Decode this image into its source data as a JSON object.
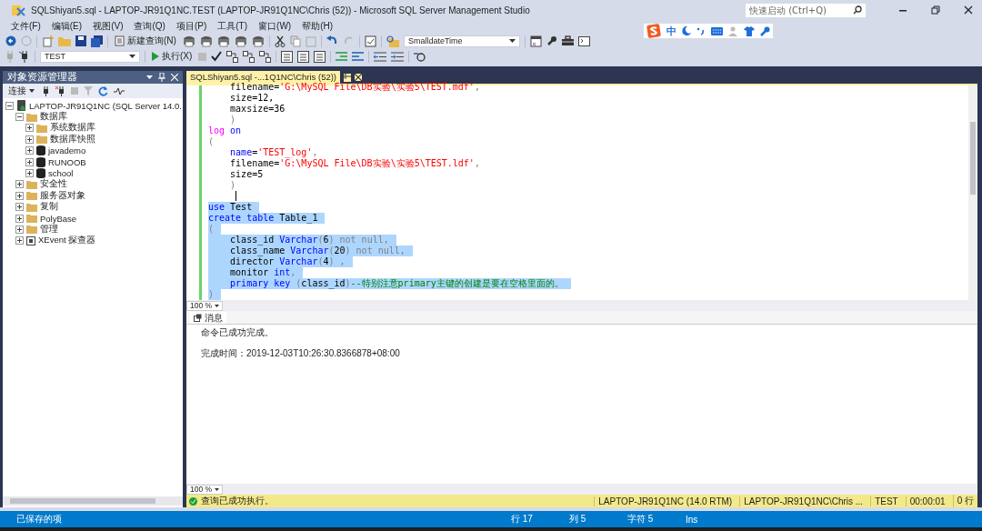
{
  "window": {
    "title": "SQLShiyan5.sql - LAPTOP-JR91Q1NC.TEST (LAPTOP-JR91Q1NC\\Chris (52)) - Microsoft SQL Server Management Studio",
    "quick_launch": {
      "placeholder": "快速启动 (Ctrl+Q)"
    }
  },
  "menu": [
    "文件(F)",
    "编辑(E)",
    "视图(V)",
    "查询(Q)",
    "项目(P)",
    "工具(T)",
    "窗口(W)",
    "帮助(H)"
  ],
  "toolbar": {
    "new_query": "新建查询(N)",
    "type_combo": "SmalldateTime",
    "database_combo": "TEST",
    "execute": "执行(X)"
  },
  "ime_bar": {
    "mode": "中"
  },
  "object_explorer": {
    "title": "对象资源管理器",
    "connect": "连接",
    "tree": [
      {
        "label": "LAPTOP-JR91Q1NC (SQL Server 14.0.",
        "kind": "server",
        "expanded": true,
        "children": [
          {
            "label": "数据库",
            "kind": "folder",
            "expanded": true,
            "children": [
              {
                "label": "系统数据库",
                "kind": "folder",
                "expanded": false
              },
              {
                "label": "数据库快照",
                "kind": "folder",
                "expanded": false
              },
              {
                "label": "javademo",
                "kind": "database",
                "expanded": false
              },
              {
                "label": "RUNOOB",
                "kind": "database",
                "expanded": false
              },
              {
                "label": "school",
                "kind": "database",
                "expanded": false
              }
            ]
          },
          {
            "label": "安全性",
            "kind": "folder",
            "expanded": false
          },
          {
            "label": "服务器对象",
            "kind": "folder",
            "expanded": false
          },
          {
            "label": "复制",
            "kind": "folder",
            "expanded": false
          },
          {
            "label": "PolyBase",
            "kind": "folder",
            "expanded": false
          },
          {
            "label": "管理",
            "kind": "folder",
            "expanded": false
          },
          {
            "label": "XEvent 探查器",
            "kind": "xevent",
            "expanded": false
          }
        ]
      }
    ]
  },
  "editor_tab": {
    "title": "SQLShiyan5.sql -...1Q1NC\\Chris (52))"
  },
  "code": [
    {
      "selected": false,
      "tokens": [
        {
          "kind": "plain",
          "text": "    filename="
        },
        {
          "kind": "str",
          "text": "'G:\\MySQL File\\DB实验\\实验5\\TEST.mdf'"
        },
        {
          "kind": "gray",
          "text": ","
        }
      ]
    },
    {
      "selected": false,
      "tokens": [
        {
          "kind": "plain",
          "text": "    size=12,"
        }
      ]
    },
    {
      "selected": false,
      "tokens": [
        {
          "kind": "plain",
          "text": "    maxsize=36"
        }
      ]
    },
    {
      "selected": false,
      "tokens": [
        {
          "kind": "gray",
          "text": "    )"
        }
      ]
    },
    {
      "selected": false,
      "tokens": [
        {
          "kind": "pink",
          "text": "log"
        },
        {
          "kind": "kw",
          "text": " on"
        }
      ]
    },
    {
      "selected": false,
      "tokens": [
        {
          "kind": "gray",
          "text": "("
        }
      ]
    },
    {
      "selected": false,
      "tokens": [
        {
          "kind": "kw",
          "text": "    name"
        },
        {
          "kind": "plain",
          "text": "="
        },
        {
          "kind": "str",
          "text": "'TEST_log'"
        },
        {
          "kind": "gray",
          "text": ","
        }
      ]
    },
    {
      "selected": false,
      "tokens": [
        {
          "kind": "plain",
          "text": "    filename="
        },
        {
          "kind": "str",
          "text": "'G:\\MySQL File\\DB实验\\实验5\\TEST.ldf'"
        },
        {
          "kind": "gray",
          "text": ","
        }
      ]
    },
    {
      "selected": false,
      "tokens": [
        {
          "kind": "plain",
          "text": "    size=5"
        }
      ]
    },
    {
      "selected": false,
      "tokens": [
        {
          "kind": "gray",
          "text": "    )"
        }
      ]
    },
    {
      "selected": false,
      "caret": true
    },
    {
      "selected": true,
      "tokens": [
        {
          "kind": "kw",
          "text": "use"
        },
        {
          "kind": "plain",
          "text": " Test"
        }
      ]
    },
    {
      "selected": true,
      "tokens": [
        {
          "kind": "kw",
          "text": "create table"
        },
        {
          "kind": "plain",
          "text": " Table_1"
        }
      ]
    },
    {
      "selected": true,
      "tokens": [
        {
          "kind": "gray",
          "text": "("
        }
      ]
    },
    {
      "selected": true,
      "tokens": [
        {
          "kind": "plain",
          "text": "    class_id "
        },
        {
          "kind": "kw",
          "text": "Varchar"
        },
        {
          "kind": "gray",
          "text": "("
        },
        {
          "kind": "plain",
          "text": "6"
        },
        {
          "kind": "gray",
          "text": ") not null,"
        }
      ]
    },
    {
      "selected": true,
      "tokens": [
        {
          "kind": "plain",
          "text": "    class_name "
        },
        {
          "kind": "kw",
          "text": "Varchar"
        },
        {
          "kind": "gray",
          "text": "("
        },
        {
          "kind": "plain",
          "text": "20"
        },
        {
          "kind": "gray",
          "text": ") not null,"
        }
      ]
    },
    {
      "selected": true,
      "tokens": [
        {
          "kind": "plain",
          "text": "    director "
        },
        {
          "kind": "kw",
          "text": "Varchar"
        },
        {
          "kind": "gray",
          "text": "("
        },
        {
          "kind": "plain",
          "text": "4"
        },
        {
          "kind": "gray",
          "text": ") ,"
        }
      ]
    },
    {
      "selected": true,
      "tokens": [
        {
          "kind": "plain",
          "text": "    monitor "
        },
        {
          "kind": "kw",
          "text": "int"
        },
        {
          "kind": "gray",
          "text": ","
        }
      ]
    },
    {
      "selected": true,
      "tokens": [
        {
          "kind": "kw",
          "text": "    primary key"
        },
        {
          "kind": "gray",
          "text": " ("
        },
        {
          "kind": "plain",
          "text": "class_id"
        },
        {
          "kind": "gray",
          "text": ")"
        },
        {
          "kind": "cmt",
          "text": "--特别注意primary主键的创建是要在空格里面的。"
        }
      ]
    },
    {
      "selected": true,
      "tokens": [
        {
          "kind": "gray",
          "text": ")"
        }
      ]
    }
  ],
  "editor_zoom": "100 %",
  "results": {
    "tab": "消息",
    "lines": [
      "命令已成功完成。",
      "完成时间：2019-12-03T10:26:30.8366878+08:00"
    ],
    "zoom": "100 %"
  },
  "query_status": {
    "message": "查询已成功执行。",
    "cells": [
      "LAPTOP-JR91Q1NC (14.0 RTM)",
      "LAPTOP-JR91Q1NC\\Chris ...",
      "TEST",
      "00:00:01",
      "0 行"
    ]
  },
  "status_bar": {
    "left": "已保存的项",
    "cells": [
      "行 17",
      "列 5",
      "字符 5",
      "Ins"
    ]
  }
}
